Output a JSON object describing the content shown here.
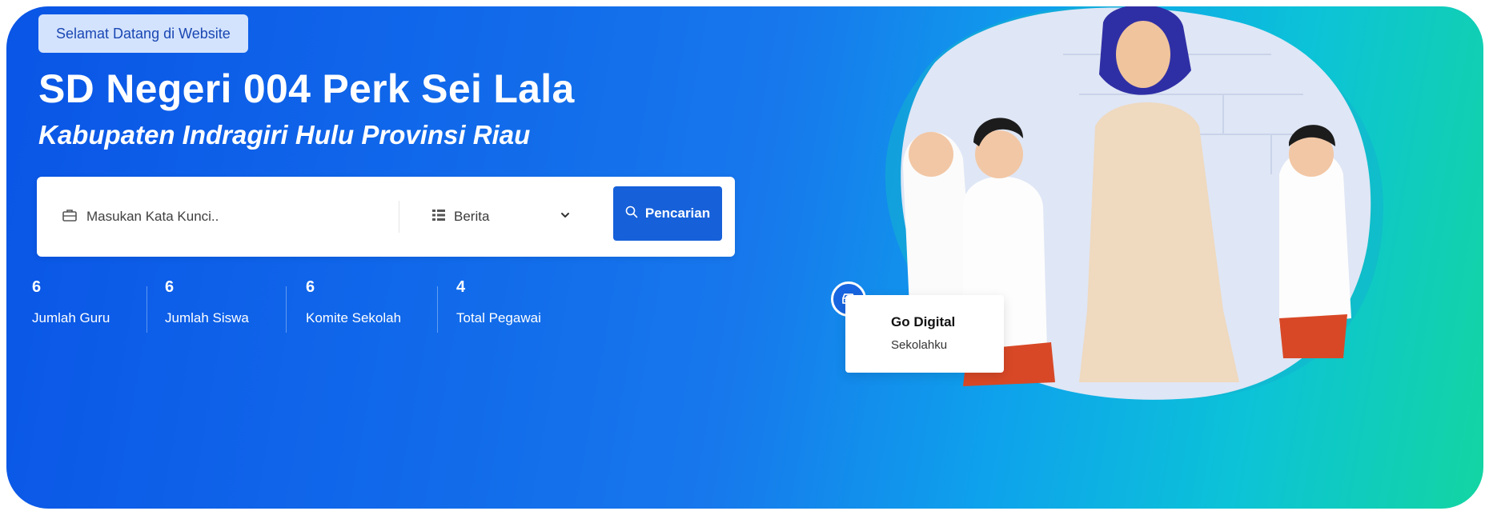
{
  "hero": {
    "welcome_badge": "Selamat Datang di Website",
    "title": "SD Negeri 004 Perk Sei Lala",
    "subtitle": "Kabupaten Indragiri Hulu Provinsi Riau"
  },
  "search": {
    "keyword_placeholder": "Masukan Kata Kunci..",
    "category_selected": "Berita",
    "button_label": "Pencarian"
  },
  "stats": [
    {
      "value": "6",
      "label": "Jumlah Guru"
    },
    {
      "value": "6",
      "label": "Jumlah Siswa"
    },
    {
      "value": "6",
      "label": "Komite Sekolah"
    },
    {
      "value": "4",
      "label": "Total Pegawai"
    }
  ],
  "promo_card": {
    "title": "Go Digital",
    "subtitle": "Sekolahku"
  },
  "colors": {
    "gradient_start": "#0a55e6",
    "gradient_end": "#13d5a2",
    "button": "#1660d9",
    "welcome_bg": "#d3e3fd",
    "welcome_text": "#1a47b3"
  },
  "icons": {
    "keyword": "briefcase-icon",
    "category": "list-icon",
    "dropdown": "chevron-down-icon",
    "search": "search-icon",
    "promo": "car-icon"
  }
}
